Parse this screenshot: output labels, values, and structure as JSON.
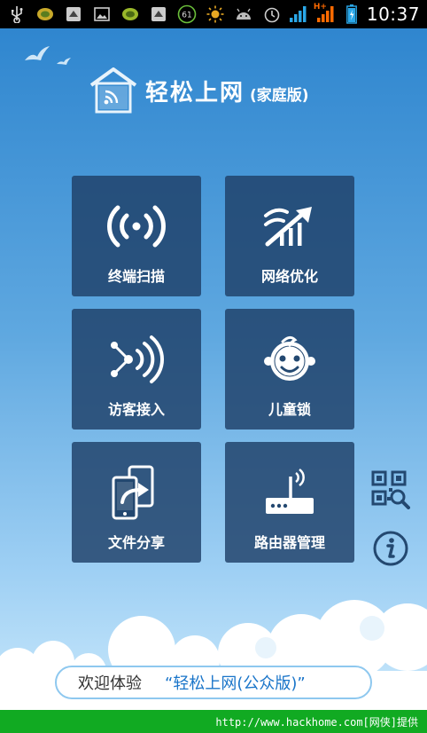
{
  "statusbar": {
    "time": "10:37",
    "badge_61": "61",
    "network_type": "H+",
    "icons": [
      "usb-icon",
      "app-icon",
      "sd-icon",
      "image-icon",
      "app-icon",
      "sd-icon",
      "badge-61-icon",
      "brightness-icon",
      "android-icon",
      "alarm-icon",
      "signal-icon",
      "signal-hplus-icon",
      "battery-icon"
    ]
  },
  "header": {
    "title": "轻松上网",
    "edition": "(家庭版)"
  },
  "tiles": [
    {
      "label": "终端扫描",
      "icon": "wireless-scan-icon"
    },
    {
      "label": "网络优化",
      "icon": "network-optimize-icon"
    },
    {
      "label": "访客接入",
      "icon": "guest-access-icon"
    },
    {
      "label": "儿童锁",
      "icon": "child-lock-icon"
    },
    {
      "label": "文件分享",
      "icon": "file-share-icon"
    },
    {
      "label": "路由器管理",
      "icon": "router-manage-icon"
    }
  ],
  "side": {
    "qr_icon": "qr-scan-icon",
    "info_icon": "info-icon"
  },
  "welcome": {
    "text": "欢迎体验",
    "app": "“轻松上网(公众版)”"
  },
  "footer": {
    "text": "http://www.hackhome.com[网侠]提供"
  },
  "colors": {
    "tile_bg": "#1e4068",
    "sky_top": "#2f86cf",
    "sky_bottom": "#c9e8fb",
    "footer_bg": "#11aa22"
  }
}
